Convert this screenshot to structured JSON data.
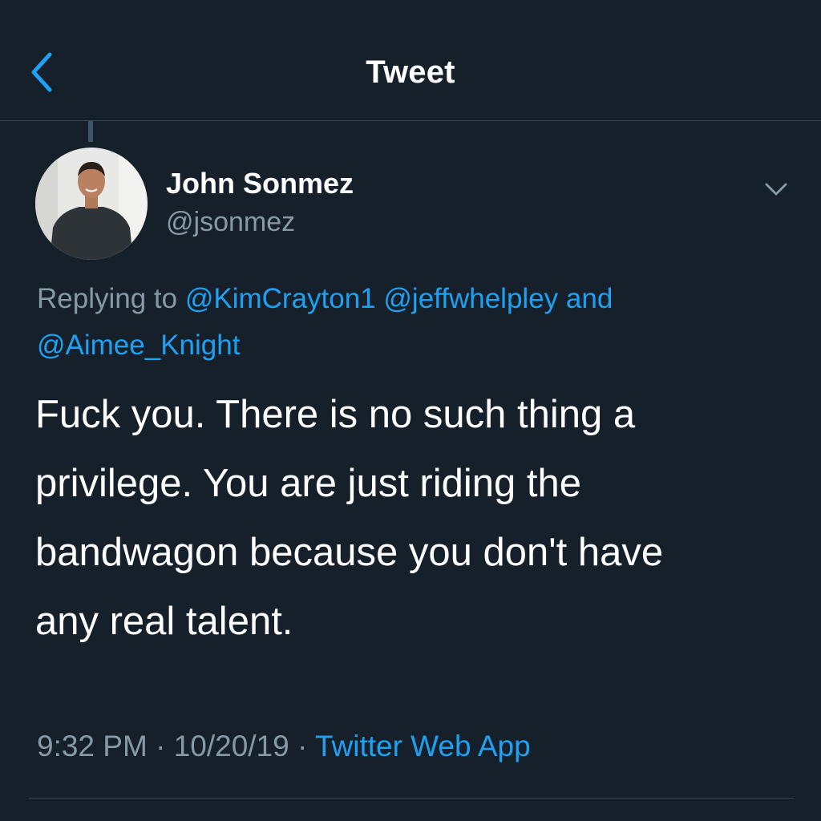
{
  "header": {
    "title": "Tweet",
    "back_icon": "chevron-left-icon"
  },
  "tweet": {
    "author": {
      "display_name": "John Sonmez",
      "handle": "@jsonmez",
      "avatar": "profile-photo"
    },
    "menu_icon": "chevron-down-icon",
    "replying_to": {
      "prefix": "Replying to ",
      "mention_1": "@KimCrayton1",
      "mention_2": "@jeffwhelpley",
      "conjunction": " and",
      "mention_3": "@Aimee_Knight"
    },
    "text_lines": [
      "Fuck you. There is no such thing a",
      "privilege. You are just riding the",
      "bandwagon because you don't have",
      "any real talent."
    ],
    "time": "9:32 PM",
    "separator": " · ",
    "date": "10/20/19",
    "source": "Twitter Web App"
  },
  "colors": {
    "background": "#15202b",
    "accent": "#1da1f2",
    "secondary_text": "#8899a6",
    "divider": "#38444d"
  }
}
